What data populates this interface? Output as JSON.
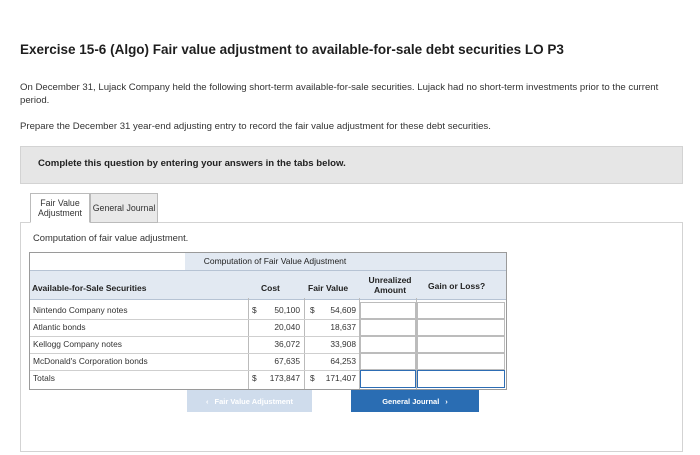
{
  "header": {
    "title": "Exercise 15-6 (Algo) Fair value adjustment to available-for-sale debt securities LO P3",
    "p1": "On December 31, Lujack Company held the following short-term available-for-sale securities. Lujack had no short-term investments prior to the current period.",
    "p2": "Prepare the December 31 year-end adjusting entry to record the fair value adjustment for these debt securities."
  },
  "instruction": "Complete this question by entering your answers in the tabs below.",
  "tabs": [
    {
      "label": "Fair Value Adjustment"
    },
    {
      "label": "General Journal"
    }
  ],
  "section_label": "Computation of fair value adjustment.",
  "table": {
    "title": "Computation of Fair Value Adjustment",
    "headers": {
      "security": "Available-for-Sale Securities",
      "cost": "Cost",
      "fair_value": "Fair Value",
      "unrealized": "Unrealized Amount",
      "gain_loss": "Gain or Loss?"
    },
    "rows": [
      {
        "name": "Nintendo Company notes",
        "cost_cur": "$",
        "cost": "50,100",
        "fv_cur": "$",
        "fv": "54,609"
      },
      {
        "name": "Atlantic bonds",
        "cost_cur": "",
        "cost": "20,040",
        "fv_cur": "",
        "fv": "18,637"
      },
      {
        "name": "Kellogg Company notes",
        "cost_cur": "",
        "cost": "36,072",
        "fv_cur": "",
        "fv": "33,908"
      },
      {
        "name": "McDonald's Corporation bonds",
        "cost_cur": "",
        "cost": "67,635",
        "fv_cur": "",
        "fv": "64,253"
      },
      {
        "name": "Totals",
        "cost_cur": "$",
        "cost": "173,847",
        "fv_cur": "$",
        "fv": "171,407"
      }
    ]
  },
  "nav": {
    "prev_label": "Fair Value Adjustment",
    "next_label": "General Journal"
  },
  "colors": {
    "accent": "#2a6db3",
    "header_band": "#e2e9f2",
    "instruction_bg": "#e6e6e6"
  }
}
